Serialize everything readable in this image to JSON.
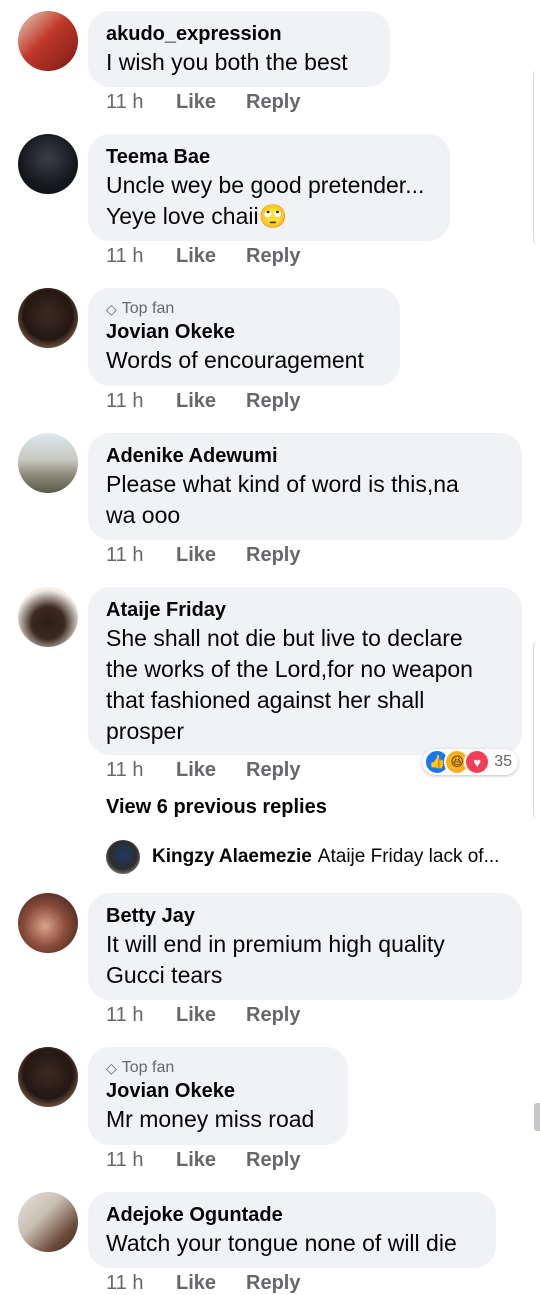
{
  "comments": [
    {
      "author": "akudo_expression",
      "badge": "",
      "lines": [
        "I wish you both the best"
      ],
      "time": "11 h",
      "like": "Like",
      "reply": "Reply"
    },
    {
      "author": "Teema Bae",
      "badge": "",
      "lines": [
        "Uncle wey be good pretender...",
        "Yeye love chaii🙄"
      ],
      "time": "11 h",
      "like": "Like",
      "reply": "Reply"
    },
    {
      "author": "Jovian Okeke",
      "badge": "Top fan",
      "lines": [
        "Words of encouragement"
      ],
      "time": "11 h",
      "like": "Like",
      "reply": "Reply"
    },
    {
      "author": "Adenike Adewumi",
      "badge": "",
      "lines": [
        "Please what kind of word is this,na",
        "wa ooo"
      ],
      "time": "11 h",
      "like": "Like",
      "reply": "Reply"
    },
    {
      "author": "Ataije Friday",
      "badge": "",
      "lines": [
        "She shall not die but live to declare",
        "the works of the Lord,for no weapon",
        "that fashioned against her shall",
        "prosper"
      ],
      "time": "11 h",
      "like": "Like",
      "reply": "Reply",
      "reaction_count": "35"
    },
    {
      "author": "Betty Jay",
      "badge": "",
      "lines": [
        "It will end in premium high quality",
        "Gucci tears"
      ],
      "time": "11 h",
      "like": "Like",
      "reply": "Reply"
    },
    {
      "author": "Jovian Okeke",
      "badge": "Top fan",
      "lines": [
        "Mr money miss road"
      ],
      "time": "11 h",
      "like": "Like",
      "reply": "Reply"
    },
    {
      "author": "Adejoke Oguntade",
      "badge": "",
      "lines": [
        "Watch your tongue none of will die"
      ],
      "time": "11 h",
      "like": "Like",
      "reply": "Reply"
    }
  ],
  "replies": {
    "view_label": "View 6 previous replies",
    "latest_author": "Kingzy Alaemezie",
    "latest_snippet": "Ataije Friday lack of..."
  },
  "icons": {
    "top_fan": "diamond-icon",
    "reactions": [
      "like-reaction-icon",
      "haha-reaction-icon",
      "love-reaction-icon"
    ]
  },
  "colors": {
    "bubble": "#f0f2f5",
    "meta": "#65676b",
    "like_blue": "#1877f2",
    "love_red": "#f33e58",
    "haha_yellow": "#f7b125"
  }
}
